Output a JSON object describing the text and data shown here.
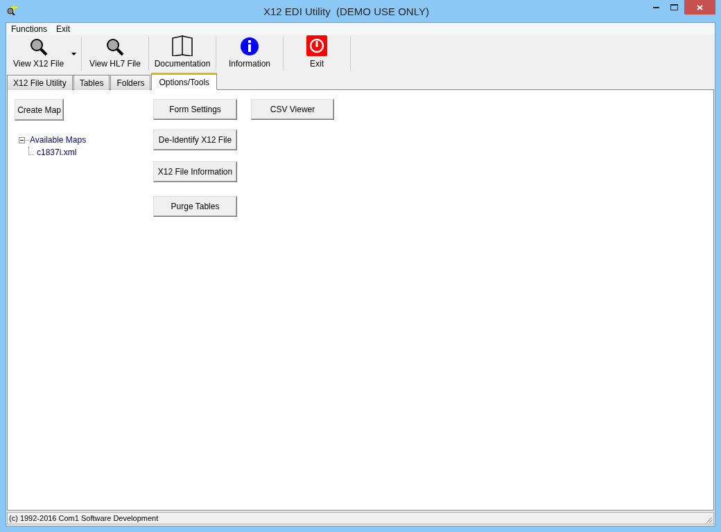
{
  "window": {
    "title": "X12 EDI Utility  (DEMO USE ONLY)"
  },
  "menu": [
    "Functions",
    "Exit"
  ],
  "toolbar": [
    {
      "label": "View X12 File",
      "dropdown": true
    },
    {
      "label": "View HL7 File",
      "dropdown": false
    },
    {
      "label": "Documentation",
      "dropdown": false
    },
    {
      "label": "Information",
      "dropdown": false
    },
    {
      "label": "Exit",
      "dropdown": false
    }
  ],
  "tabs": [
    {
      "label": "X12 File Utility",
      "selected": false
    },
    {
      "label": "Tables",
      "selected": false
    },
    {
      "label": "Folders",
      "selected": false
    },
    {
      "label": "Options/Tools",
      "selected": true
    }
  ],
  "create_map_button": "Create Map",
  "tree": {
    "label": "Available Maps",
    "expanded": true,
    "children": [
      {
        "label": "c1837i.xml"
      }
    ]
  },
  "tool_buttons": [
    "Form Settings",
    "De-Identify X12 File",
    "X12 File Information",
    "Purge Tables"
  ],
  "csv_button": "CSV Viewer",
  "status_bar": "(c) 1992-2016 Com1 Software Development"
}
